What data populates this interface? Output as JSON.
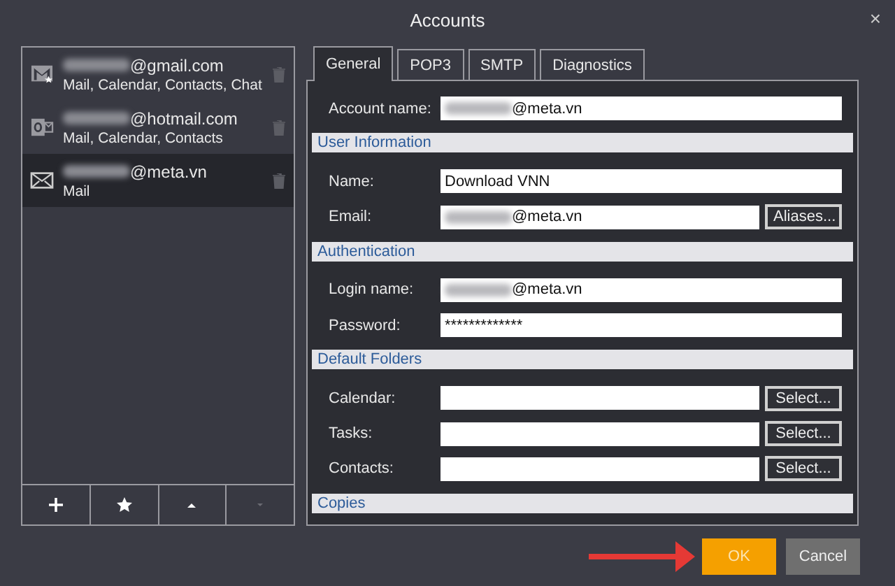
{
  "window": {
    "title": "Accounts",
    "close": "×"
  },
  "accounts": [
    {
      "kind": "gmail",
      "redacted": true,
      "address": "@gmail.com",
      "services": "Mail, Calendar, Contacts, Chat",
      "selected": false
    },
    {
      "kind": "outlook",
      "redacted": true,
      "address": "@hotmail.com",
      "services": "Mail, Calendar, Contacts",
      "selected": false
    },
    {
      "kind": "mail",
      "redacted": true,
      "address": "@meta.vn",
      "services": "Mail",
      "selected": true
    }
  ],
  "list_toolbar": [
    {
      "kind": "plus",
      "disabled": false
    },
    {
      "kind": "star",
      "disabled": false
    },
    {
      "kind": "up",
      "disabled": false
    },
    {
      "kind": "down",
      "disabled": true
    }
  ],
  "tabs": [
    {
      "label": "General",
      "selected": true
    },
    {
      "label": "POP3",
      "selected": false
    },
    {
      "label": "SMTP",
      "selected": false
    },
    {
      "label": "Diagnostics",
      "selected": false
    }
  ],
  "form": [
    {
      "kind": "field",
      "label": "Account name:",
      "value": "@meta.vn",
      "redacted": true
    },
    {
      "kind": "section",
      "label": "User Information"
    },
    {
      "kind": "field",
      "label": "Name:",
      "value": "Download VNN"
    },
    {
      "kind": "field",
      "label": "Email:",
      "value": "@meta.vn",
      "redacted": true,
      "button": "Aliases..."
    },
    {
      "kind": "section",
      "label": "Authentication"
    },
    {
      "kind": "field",
      "label": "Login name:",
      "value": "@meta.vn",
      "redacted": true
    },
    {
      "kind": "field",
      "label": "Password:",
      "value": "*************"
    },
    {
      "kind": "section",
      "label": "Default Folders"
    },
    {
      "kind": "field",
      "label": "Calendar:",
      "button": "Select..."
    },
    {
      "kind": "field",
      "label": "Tasks:",
      "button": "Select..."
    },
    {
      "kind": "field",
      "label": "Contacts:",
      "button": "Select..."
    },
    {
      "kind": "section",
      "label": "Copies"
    }
  ],
  "buttons": [
    {
      "label": "OK",
      "kind": "primary",
      "pointed_at": true
    },
    {
      "label": "Cancel",
      "kind": "secondary"
    }
  ]
}
